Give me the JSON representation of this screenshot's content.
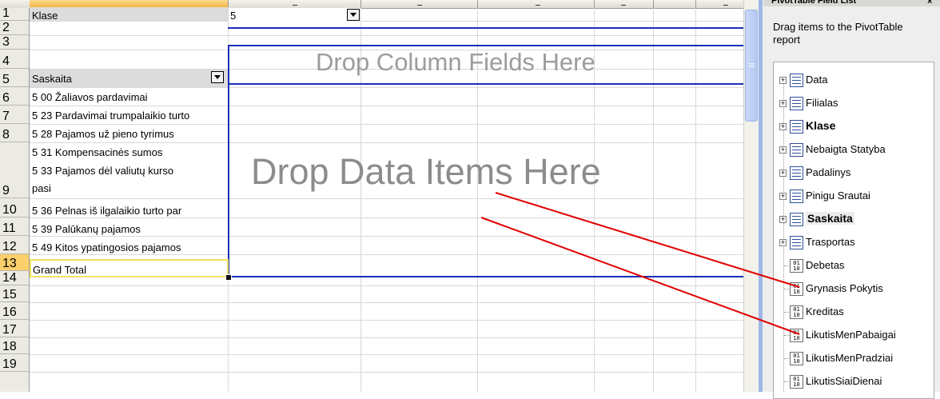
{
  "sheet": {
    "rows": [
      "1",
      "2",
      "3",
      "4",
      "5",
      "6",
      "7",
      "8",
      "9",
      "10",
      "11",
      "12",
      "13",
      "14",
      "15",
      "16",
      "17",
      "18",
      "19"
    ],
    "page_field": {
      "label": "Klase",
      "value": "5"
    },
    "row_field_header": "Saskaita",
    "row_items": [
      "5 00 Žaliavos pardavimai",
      "5 23 Pardavimai trumpalaikio turto",
      "5 28 Pajamos už pieno tyrimus",
      "5 31 Kompensacinės sumos",
      "5 33 Pajamos dėl valiutų kurso",
      "pasi",
      "5 36 Pelnas iš ilgalaikio turto par",
      "5 39 Palūkanų pajamos",
      "5 49 Kitos ypatingosios pajamos"
    ],
    "grand_total": "Grand Total",
    "drop_column": "Drop Column Fields Here",
    "drop_data": "Drop Data Items Here"
  },
  "pane": {
    "title": "PivotTable Field List",
    "close": "×",
    "hint": "Drag items to the PivotTable report",
    "dimension_fields": [
      {
        "label": "Data",
        "style": "normal"
      },
      {
        "label": "Filialas",
        "style": "normal"
      },
      {
        "label": "Klase",
        "style": "bold"
      },
      {
        "label": "Nebaigta Statyba",
        "style": "normal"
      },
      {
        "label": "Padalinys",
        "style": "normal"
      },
      {
        "label": "Pinigu Srautai",
        "style": "normal"
      },
      {
        "label": "Saskaita",
        "style": "bold-boxed"
      },
      {
        "label": "Trasportas",
        "style": "normal"
      }
    ],
    "measure_fields": [
      "Debetas",
      "Grynasis Pokytis",
      "Kreditas",
      "LikutisMenPabaigai",
      "LikutisMenPradziai",
      "LikutisSiaiDienai"
    ],
    "measure_icon_text": "01 10",
    "expand_glyph": "+"
  },
  "colors": {
    "accent_blue": "#1a2fb8",
    "annotation_red": "#e00000",
    "active_row": "#fbcf6a",
    "cell_highlight": "#f2e25e"
  }
}
